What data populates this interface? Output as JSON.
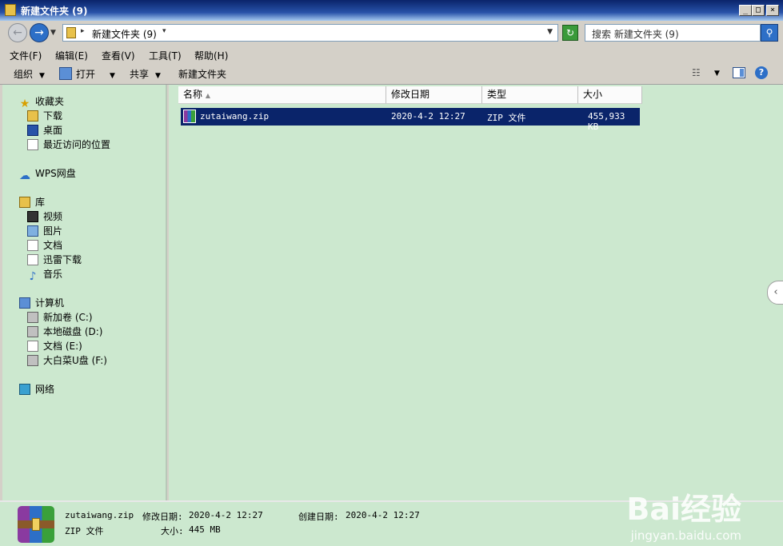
{
  "window": {
    "title": "新建文件夹 (9)"
  },
  "titlebar_buttons": {
    "minimize": "_",
    "maximize": "□",
    "close": "×"
  },
  "address": {
    "path": "新建文件夹 (9)"
  },
  "search": {
    "placeholder": "搜索 新建文件夹 (9)"
  },
  "menu": [
    "文件(F)",
    "编辑(E)",
    "查看(V)",
    "工具(T)",
    "帮助(H)"
  ],
  "toolbar": {
    "organize": "组织",
    "open": "打开",
    "share": "共享",
    "new_folder": "新建文件夹"
  },
  "nav": {
    "favorites": {
      "label": "收藏夹",
      "items": [
        "下载",
        "桌面",
        "最近访问的位置"
      ]
    },
    "wps": "WPS网盘",
    "library": {
      "label": "库",
      "items": [
        "视频",
        "图片",
        "文档",
        "迅雷下载",
        "音乐"
      ]
    },
    "computer": {
      "label": "计算机",
      "items": [
        "新加卷 (C:)",
        "本地磁盘 (D:)",
        "文档 (E:)",
        "大白菜U盘 (F:)"
      ]
    },
    "network": "网络"
  },
  "columns": [
    "名称",
    "修改日期",
    "类型",
    "大小"
  ],
  "files": [
    {
      "name": "zutaiwang.zip",
      "modified": "2020-4-2 12:27",
      "type": "ZIP 文件",
      "size": "455,933 KB"
    }
  ],
  "status": {
    "filename": "zutaiwang.zip",
    "modified_label": "修改日期:",
    "modified": "2020-4-2 12:27",
    "created_label": "创建日期:",
    "created": "2020-4-2 12:27",
    "type": "ZIP 文件",
    "size_label": "大小:",
    "size": "445 MB"
  },
  "watermark": {
    "brand": "Bai经验",
    "url": "jingyan.baidu.com"
  },
  "colors": {
    "pane_bg": "#cce8cf",
    "selection": "#0a246a",
    "titlebar": "#0a246a"
  },
  "icons": [
    "folder-icon",
    "back-arrow-icon",
    "forward-arrow-icon",
    "refresh-icon",
    "search-icon",
    "open-icon",
    "view-options-icon",
    "preview-pane-icon",
    "help-icon",
    "star-icon",
    "cloud-icon",
    "zip-archive-icon"
  ]
}
